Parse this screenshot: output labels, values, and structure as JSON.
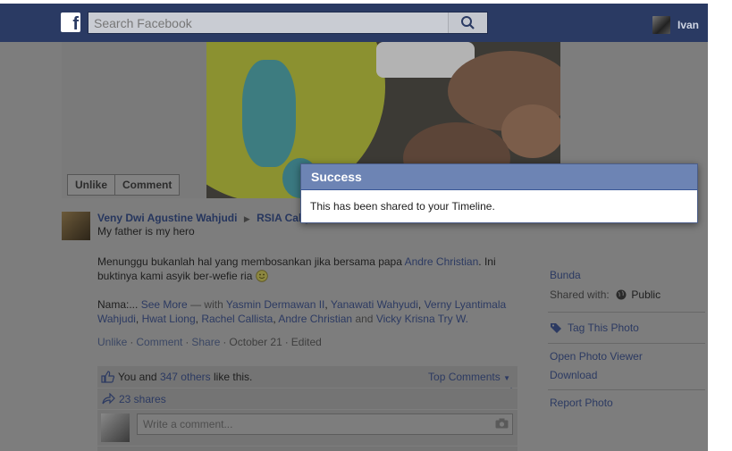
{
  "topbar": {
    "logo_letter": "f",
    "search_placeholder": "Search Facebook",
    "profile_name": "Ivan"
  },
  "photo_actions": {
    "unlike": "Unlike",
    "comment": "Comment"
  },
  "post": {
    "author": "Veny Dwi Agustine Wahjudi",
    "place": "RSIA Cahy",
    "line1": "My father is my hero",
    "para2_text": "Menunggu bukanlah hal yang membosankan jika bersama papa ",
    "para2_link": "Andre Christian",
    "para2_rest": ". Ini buktinya kami asyik ber-wefie ria",
    "para3_prefix": "Nama:...",
    "see_more": "See More",
    "with_text": "— with",
    "tag1": "Yasmin Dermawan II",
    "tag2": "Yanawati Wahyudi",
    "tag3": "Verny Lyantimala Wahjudi",
    "tag4": "Hwat Liong",
    "tag5": "Rachel Callista",
    "tag6": "Andre Christian",
    "and_text": "and",
    "tag7": "Vicky Krisna Try W.",
    "actions": {
      "unlike": "Unlike",
      "comment": "Comment",
      "share": "Share",
      "date": "October 21",
      "edited": "Edited"
    }
  },
  "likes": {
    "you_and": "You and",
    "others": "347 others",
    "like_this": "like this.",
    "top_comments": "Top Comments"
  },
  "shares": {
    "count": "23 shares"
  },
  "comment": {
    "placeholder": "Write a comment..."
  },
  "right_col": {
    "bunda": "Bunda",
    "shared_with": "Shared with:",
    "audience": "Public",
    "tag_photo": "Tag This Photo",
    "open_viewer": "Open Photo Viewer",
    "download": "Download",
    "report": "Report Photo"
  },
  "dialog": {
    "title": "Success",
    "message": "This has been shared to your Timeline."
  },
  "icons": {
    "logo": "facebook-logo-icon",
    "search": "search-icon",
    "like": "thumbs-up-icon",
    "share": "share-arrow-icon",
    "camera": "camera-icon",
    "globe": "globe-icon",
    "tag": "tag-icon",
    "audience": "audience-selector-icon"
  },
  "colors": {
    "topbar": "#2a3a63",
    "dialog_header": "#6d84b4",
    "link": "#2c3a62"
  }
}
